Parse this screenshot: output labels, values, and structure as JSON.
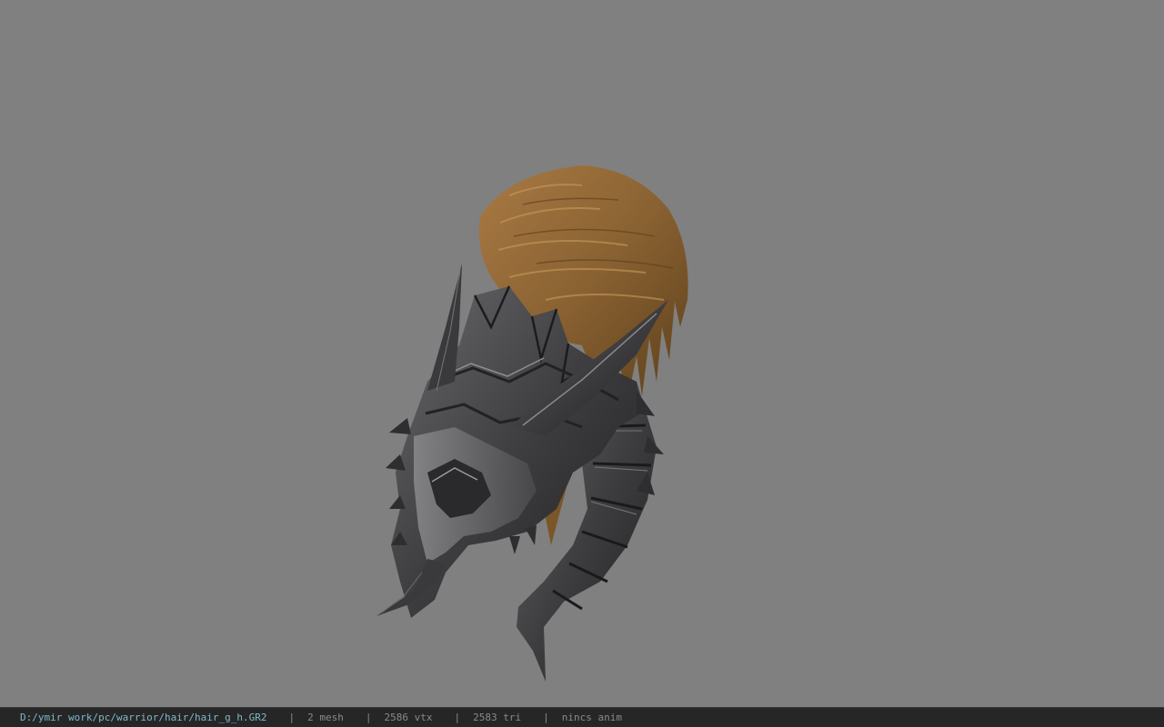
{
  "viewer": {
    "background_color": "#808080",
    "model": {
      "icon": "helmet-with-hair-model",
      "hair_color": "#8a6232",
      "armor_color": "#3e3d3f"
    }
  },
  "status_bar": {
    "file_path": "D:/ymir work/pc/warrior/hair/hair_g_h.GR2",
    "separator": "|",
    "mesh": "2 mesh",
    "vertices": "2586 vtx",
    "triangles": "2583 tri",
    "animation": "nincs anim",
    "path_color": "#7fb8c8"
  }
}
